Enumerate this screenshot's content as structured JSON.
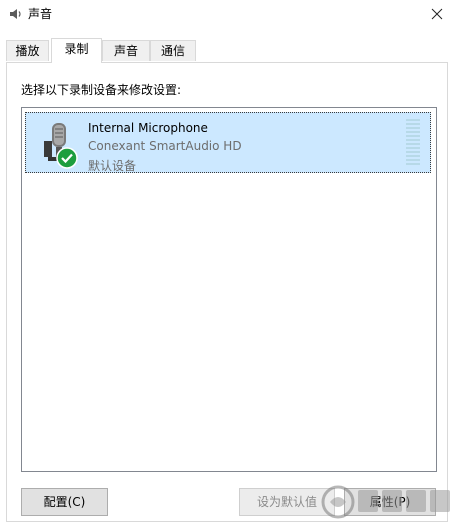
{
  "window": {
    "title": "声音",
    "icon": "speaker-icon",
    "close_icon": "close-icon"
  },
  "tabs": [
    {
      "label": "播放",
      "active": false
    },
    {
      "label": "录制",
      "active": true
    },
    {
      "label": "声音",
      "active": false
    },
    {
      "label": "通信",
      "active": false
    }
  ],
  "panel": {
    "instruction": "选择以下录制设备来修改设置:",
    "devices": [
      {
        "name": "Internal Microphone",
        "driver": "Conexant SmartAudio HD",
        "status": "默认设备",
        "icon": "microphone-icon",
        "badge": "default-check-icon",
        "selected": true
      }
    ]
  },
  "buttons": {
    "configure": "配置(C)",
    "set_default": "设为默认值",
    "properties": "属性(P)"
  },
  "colors": {
    "selection": "#cce8ff",
    "check_badge": "#1e9e3e",
    "level_meter": "#b7d9e8"
  }
}
